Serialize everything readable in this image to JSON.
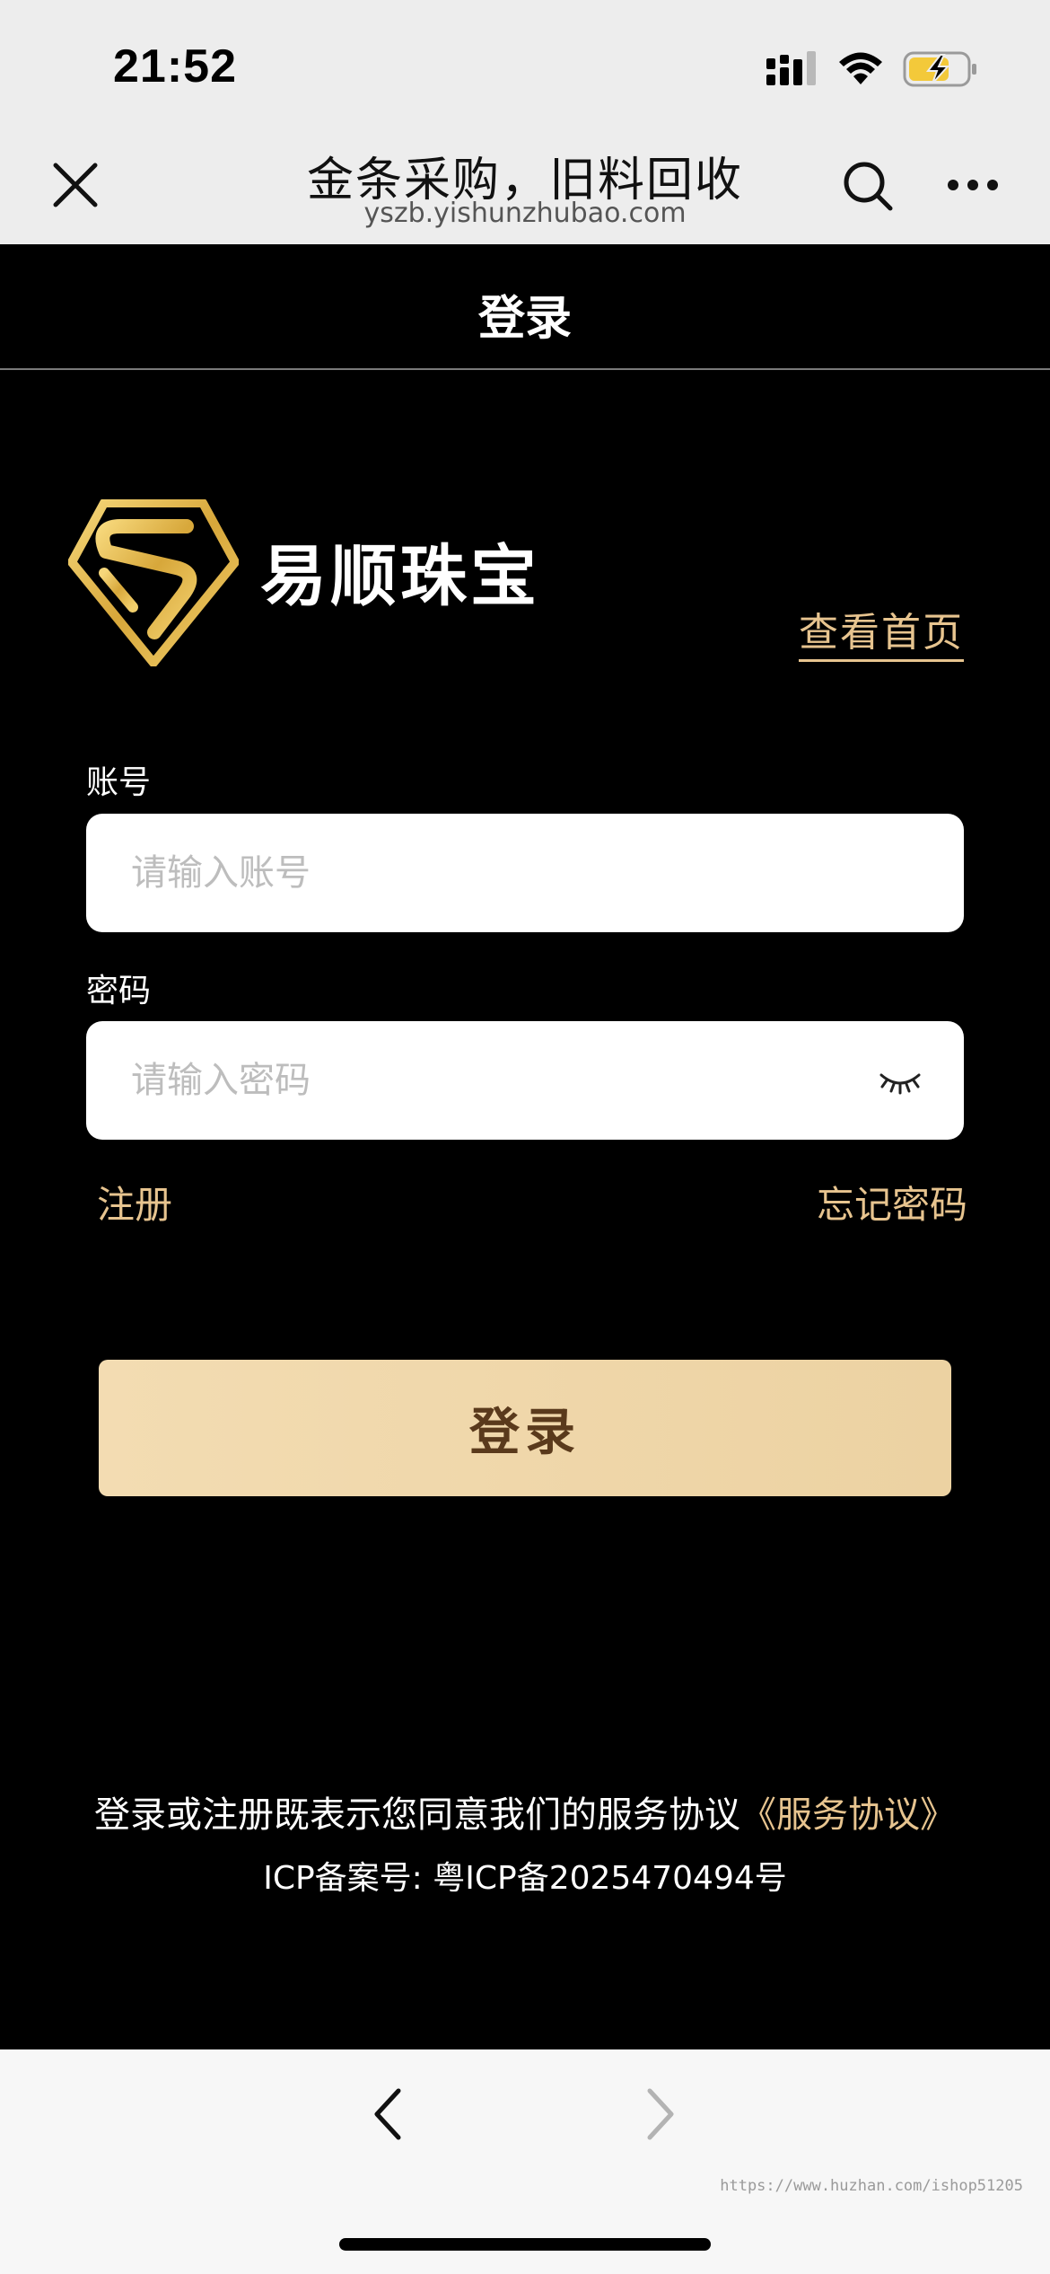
{
  "status_bar": {
    "time": "21:52"
  },
  "browser": {
    "title": "金条采购，旧料回收",
    "url": "yszb.yishunzhubao.com"
  },
  "page": {
    "title": "登录"
  },
  "brand": {
    "name": "易顺珠宝",
    "home_link": "查看首页"
  },
  "form": {
    "account_label": "账号",
    "account_placeholder": "请输入账号",
    "account_value": "",
    "password_label": "密码",
    "password_placeholder": "请输入密码",
    "password_value": "",
    "register_link": "注册",
    "forgot_link": "忘记密码",
    "login_button": "登录"
  },
  "footer": {
    "agreement_text": "登录或注册既表示您同意我们的服务协议",
    "agreement_link": "《服务协议》",
    "icp": "ICP备案号: 粤ICP备2025470494号"
  },
  "watermark": "https://www.huzhan.com/ishop51205",
  "colors": {
    "accent_gold": "#e7c48f",
    "button_gradient_start": "#f3dcb2",
    "button_gradient_end": "#ecd2a2",
    "button_text": "#5a3a1c",
    "background": "#000000",
    "chrome_bar": "#ededed"
  },
  "icons": {
    "close": "close-icon",
    "search": "search-icon",
    "more": "more-icon",
    "eye": "eye-closed-icon",
    "back": "chevron-left-icon",
    "forward": "chevron-right-icon",
    "battery": "battery-charging-icon",
    "wifi": "wifi-icon",
    "signal": "signal-icon"
  }
}
